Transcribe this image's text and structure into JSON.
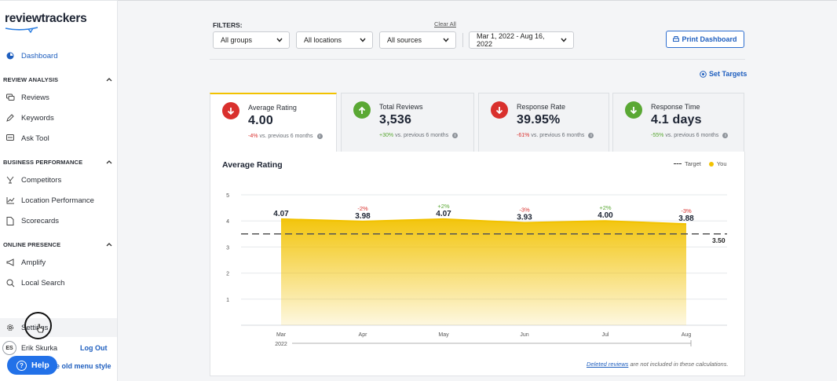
{
  "brand": {
    "name": "reviewtrackers"
  },
  "sidebar": {
    "dashboard": "Dashboard",
    "sections": [
      {
        "title": "REVIEW ANALYSIS",
        "items": [
          "Reviews",
          "Keywords",
          "Ask Tool"
        ]
      },
      {
        "title": "BUSINESS PERFORMANCE",
        "items": [
          "Competitors",
          "Location Performance",
          "Scorecards"
        ]
      },
      {
        "title": "ONLINE PRESENCE",
        "items": [
          "Amplify",
          "Local Search"
        ]
      }
    ],
    "settings": "Settings",
    "user": {
      "initials": "ES",
      "name": "Erik Skurka",
      "logout": "Log Out"
    },
    "help": "Help",
    "old_menu": "e old menu style"
  },
  "filters": {
    "label": "FILTERS:",
    "clear_all": "Clear All",
    "groups": "All groups",
    "locations": "All locations",
    "sources": "All sources",
    "date_range": "Mar 1, 2022 - Aug 16, 2022"
  },
  "actions": {
    "print": "Print Dashboard",
    "set_targets": "Set Targets"
  },
  "cards": [
    {
      "title": "Average Rating",
      "value": "4.00",
      "delta": "-4%",
      "suffix": "vs. previous 6 months",
      "direction": "down",
      "color": "#d9302d"
    },
    {
      "title": "Total Reviews",
      "value": "3,536",
      "delta": "+30%",
      "suffix": "vs. previous 6 months",
      "direction": "up",
      "color": "#5aa834"
    },
    {
      "title": "Response Rate",
      "value": "39.95%",
      "delta": "-61%",
      "suffix": "vs. previous 6 months",
      "direction": "down",
      "color": "#d9302d"
    },
    {
      "title": "Response Time",
      "value": "4.1 days",
      "delta": "-55%",
      "suffix": "vs. previous 6 months",
      "direction": "down",
      "color": "#5aa834"
    }
  ],
  "chart_data": {
    "type": "area",
    "title": "Average Rating",
    "categories": [
      "Mar",
      "Apr",
      "May",
      "Jun",
      "Jul",
      "Aug"
    ],
    "year_label": "2022",
    "ylim": [
      0,
      5
    ],
    "yticks": [
      1,
      2,
      3,
      4,
      5
    ],
    "series": [
      {
        "name": "You",
        "values": [
          4.07,
          3.98,
          4.07,
          3.93,
          4.0,
          3.88
        ],
        "labels": [
          "4.07",
          "3.98",
          "4.07",
          "3.93",
          "4.00",
          "3.88"
        ],
        "color": "#f2c200"
      }
    ],
    "changes": [
      "",
      "-2%",
      "+2%",
      "-3%",
      "+2%",
      "-3%"
    ],
    "change_colors": [
      "",
      "#d9302d",
      "#5aa834",
      "#d9302d",
      "#5aa834",
      "#d9302d"
    ],
    "target": {
      "name": "Target",
      "value": 3.5,
      "label": "3.50"
    },
    "legend": [
      "Target",
      "You"
    ],
    "legend_position": "top-right",
    "grid": true
  },
  "footer_note": {
    "link": "Deleted reviews",
    "text": "are not included in these calculations."
  }
}
